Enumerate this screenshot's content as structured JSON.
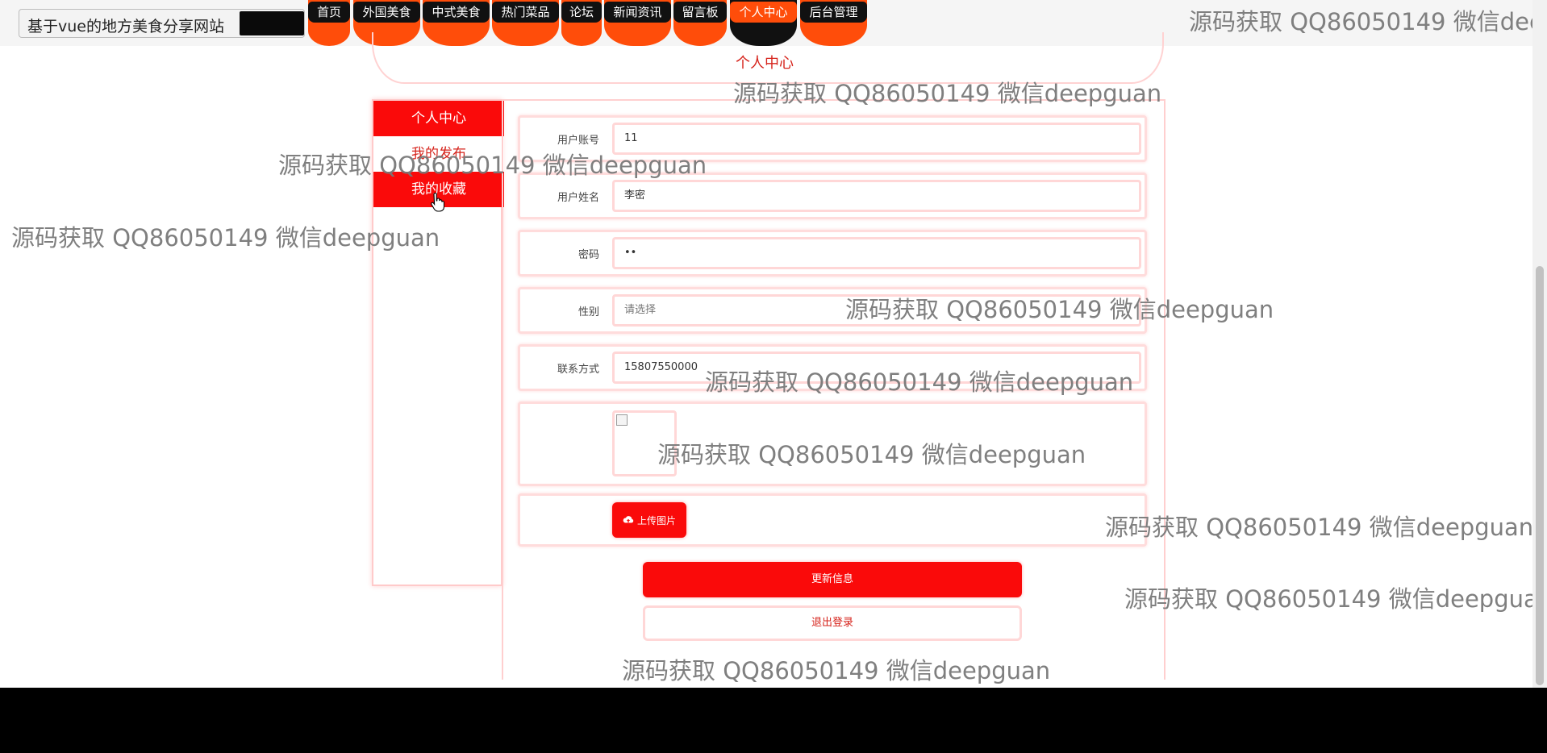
{
  "site_title": "基于vue的地方美食分享网站",
  "nav": {
    "items": [
      {
        "label": "首页"
      },
      {
        "label": "外国美食"
      },
      {
        "label": "中式美食"
      },
      {
        "label": "热门菜品"
      },
      {
        "label": "论坛"
      },
      {
        "label": "新闻资讯"
      },
      {
        "label": "留言板"
      },
      {
        "label": "个人中心"
      },
      {
        "label": "后台管理"
      }
    ],
    "active": "个人中心"
  },
  "page_caption": "个人中心",
  "sidebar": {
    "items": [
      {
        "label": "个人中心"
      },
      {
        "label": "我的发布"
      },
      {
        "label": "我的收藏"
      }
    ]
  },
  "form": {
    "account": {
      "label": "用户账号",
      "value": "11"
    },
    "name": {
      "label": "用户姓名",
      "value": "李密"
    },
    "password": {
      "label": "密码",
      "value": "••"
    },
    "gender": {
      "label": "性别",
      "placeholder": "请选择"
    },
    "phone": {
      "label": "联系方式",
      "value": "15807550000"
    },
    "upload_label": "上传图片"
  },
  "buttons": {
    "update": "更新信息",
    "logout": "退出登录"
  },
  "watermark": "源码获取 QQ86050149 微信deepguan",
  "watermark_cut": "源码获取 QQ86050149 微信dee",
  "colors": {
    "accent_red": "#fa0a0a",
    "nav_orange": "#ff4d0a",
    "text_red": "#d6231b"
  }
}
